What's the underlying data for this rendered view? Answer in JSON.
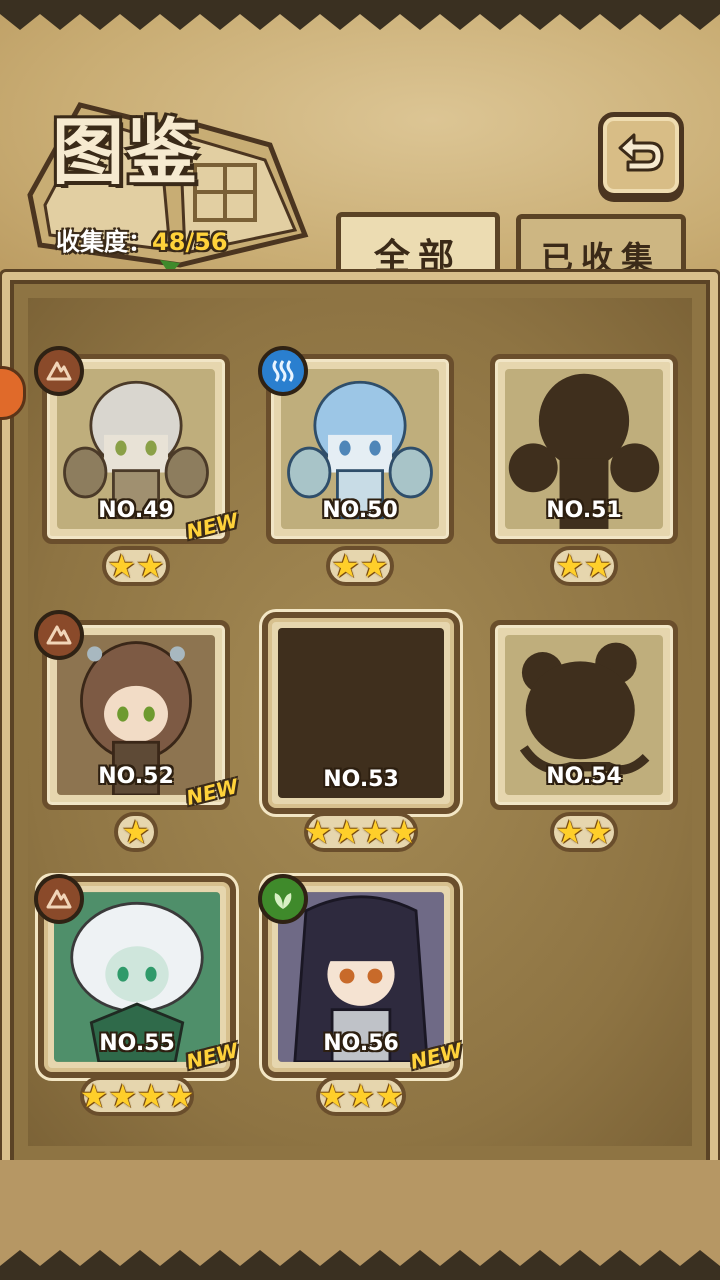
{
  "header": {
    "title": "图鉴",
    "collection_label": "收集度：",
    "collection_value": "48/56",
    "back_icon": "return-arrow-icon"
  },
  "tabs": [
    {
      "label": "全部",
      "active": true
    },
    {
      "label": "已收集",
      "active": false
    }
  ],
  "colors": {
    "earth": "#8a4a2a",
    "water": "#2a7fcf",
    "leaf": "#3f8a2b",
    "star": "#ffcf2a",
    "new": "#ffd23a"
  },
  "cards": [
    {
      "no": "NO.49",
      "stars": "★★",
      "element": "earth",
      "new": "NEW",
      "collected": true
    },
    {
      "no": "NO.50",
      "stars": "★★",
      "element": "water",
      "new": "",
      "collected": true
    },
    {
      "no": "NO.51",
      "stars": "★★",
      "element": "",
      "new": "",
      "collected": false
    },
    {
      "no": "NO.52",
      "stars": "★",
      "element": "earth",
      "new": "NEW",
      "collected": true
    },
    {
      "no": "NO.53",
      "stars": "★★★★",
      "element": "",
      "new": "",
      "collected": false
    },
    {
      "no": "NO.54",
      "stars": "★★",
      "element": "",
      "new": "",
      "collected": false
    },
    {
      "no": "NO.55",
      "stars": "★★★★",
      "element": "earth",
      "new": "NEW",
      "collected": true
    },
    {
      "no": "NO.56",
      "stars": "★★★",
      "element": "leaf",
      "new": "NEW",
      "collected": true
    }
  ]
}
